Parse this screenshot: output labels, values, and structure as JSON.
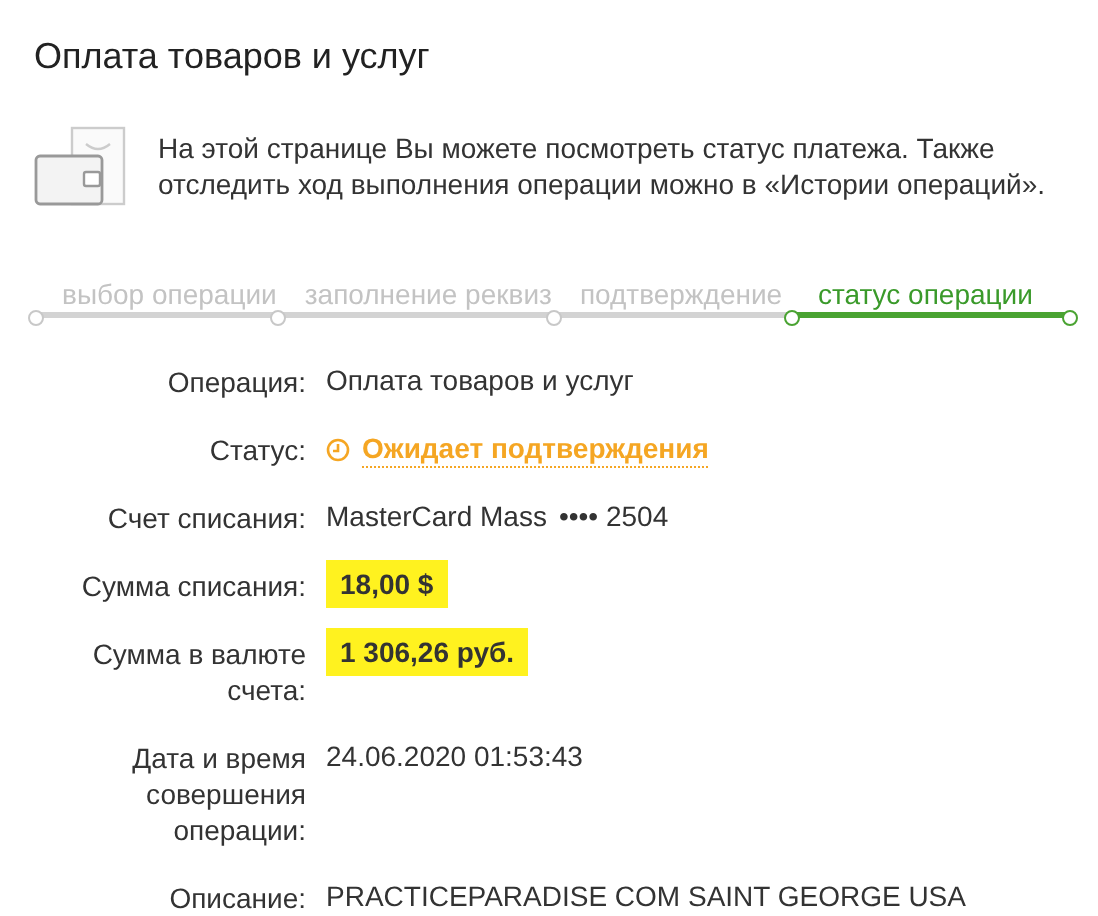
{
  "title": "Оплата товаров и услуг",
  "info": "На этой странице Вы можете посмотреть статус платежа. Также отследить ход выполнения операции можно в «Истории операций».",
  "steps": [
    {
      "label": "выбор операции",
      "selected": false
    },
    {
      "label": "заполнение реквиз",
      "selected": false
    },
    {
      "label": "подтверждение",
      "selected": false
    },
    {
      "label": "статус операции",
      "selected": true
    }
  ],
  "details": [
    {
      "kind": "text",
      "label": "Операция:",
      "value": "Оплата товаров и услуг"
    },
    {
      "kind": "status",
      "label": "Статус:",
      "value": "Ожидает подтверждения"
    },
    {
      "kind": "account",
      "label": "Счет списания:",
      "value": "MasterCard Mass",
      "mask": "•••• 2504"
    },
    {
      "kind": "highlight",
      "label": "Сумма списания:",
      "value": "18,00 $"
    },
    {
      "kind": "highlight",
      "label": "Сумма в валюте счета:",
      "value": "1 306,26 руб."
    },
    {
      "kind": "text",
      "label": "Дата и время совершения операции:",
      "value": "24.06.2020 01:53:43"
    },
    {
      "kind": "text",
      "label": "Описание:",
      "value": "PRACTICEPARADISE COM SAINT GEORGE USA"
    }
  ]
}
